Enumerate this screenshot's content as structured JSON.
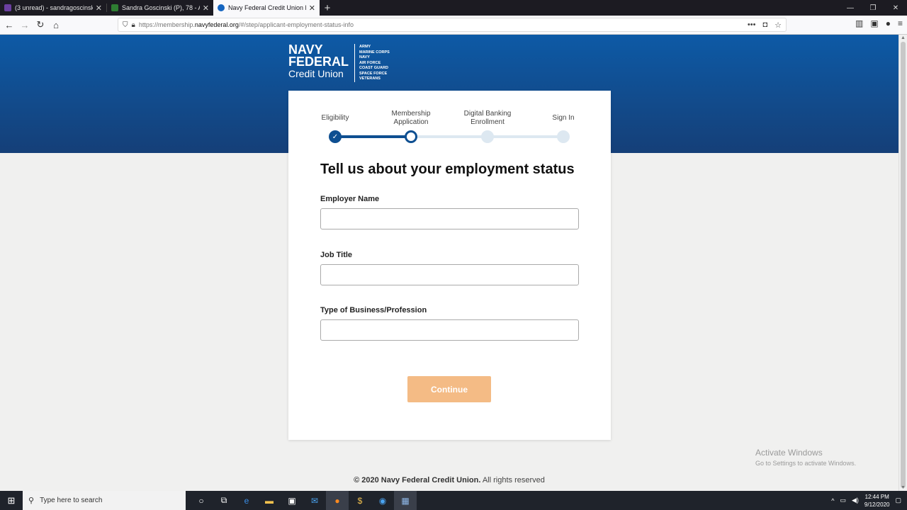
{
  "browser": {
    "tabs": [
      {
        "title": "(3 unread) - sandragoscinski@",
        "color": "#6b3fa0",
        "active": false
      },
      {
        "title": "Sandra Goscinski (P), 78 - Abin",
        "color": "#2e7d32",
        "active": false
      },
      {
        "title": "Navy Federal Credit Union Me",
        "color": "#1565c0",
        "active": true
      }
    ],
    "url_prefix": "https://membership.",
    "url_domain": "navyfederal.org",
    "url_suffix": "/#/step/applicant-employment-status-info"
  },
  "logo": {
    "line1": "NAVY",
    "line2": "FEDERAL",
    "line3": "Credit Union",
    "branches": [
      "ARMY",
      "MARINE CORPS",
      "NAVY",
      "AIR FORCE",
      "COAST GUARD",
      "SPACE FORCE",
      "VETERANS"
    ]
  },
  "stepper": {
    "steps": [
      {
        "label": "Eligibility",
        "status": "complete"
      },
      {
        "label": "Membership Application",
        "status": "current"
      },
      {
        "label": "Digital Banking Enrollment",
        "status": "upcoming"
      },
      {
        "label": "Sign In",
        "status": "upcoming"
      }
    ]
  },
  "form": {
    "heading": "Tell us about your employment status",
    "employer_label": "Employer Name",
    "job_title_label": "Job Title",
    "business_label": "Type of Business/Profession",
    "continue_label": "Continue"
  },
  "footer": {
    "copyright_bold": "© 2020 Navy Federal Credit Union.",
    "copyright_rest": " All rights reserved"
  },
  "watermark": {
    "line1": "Activate Windows",
    "line2": "Go to Settings to activate Windows."
  },
  "taskbar": {
    "search_placeholder": "Type here to search",
    "time": "12:44 PM",
    "date": "9/12/2020"
  },
  "colors": {
    "brand_blue": "#0e4f91",
    "continue_disabled": "#f4bb85"
  }
}
